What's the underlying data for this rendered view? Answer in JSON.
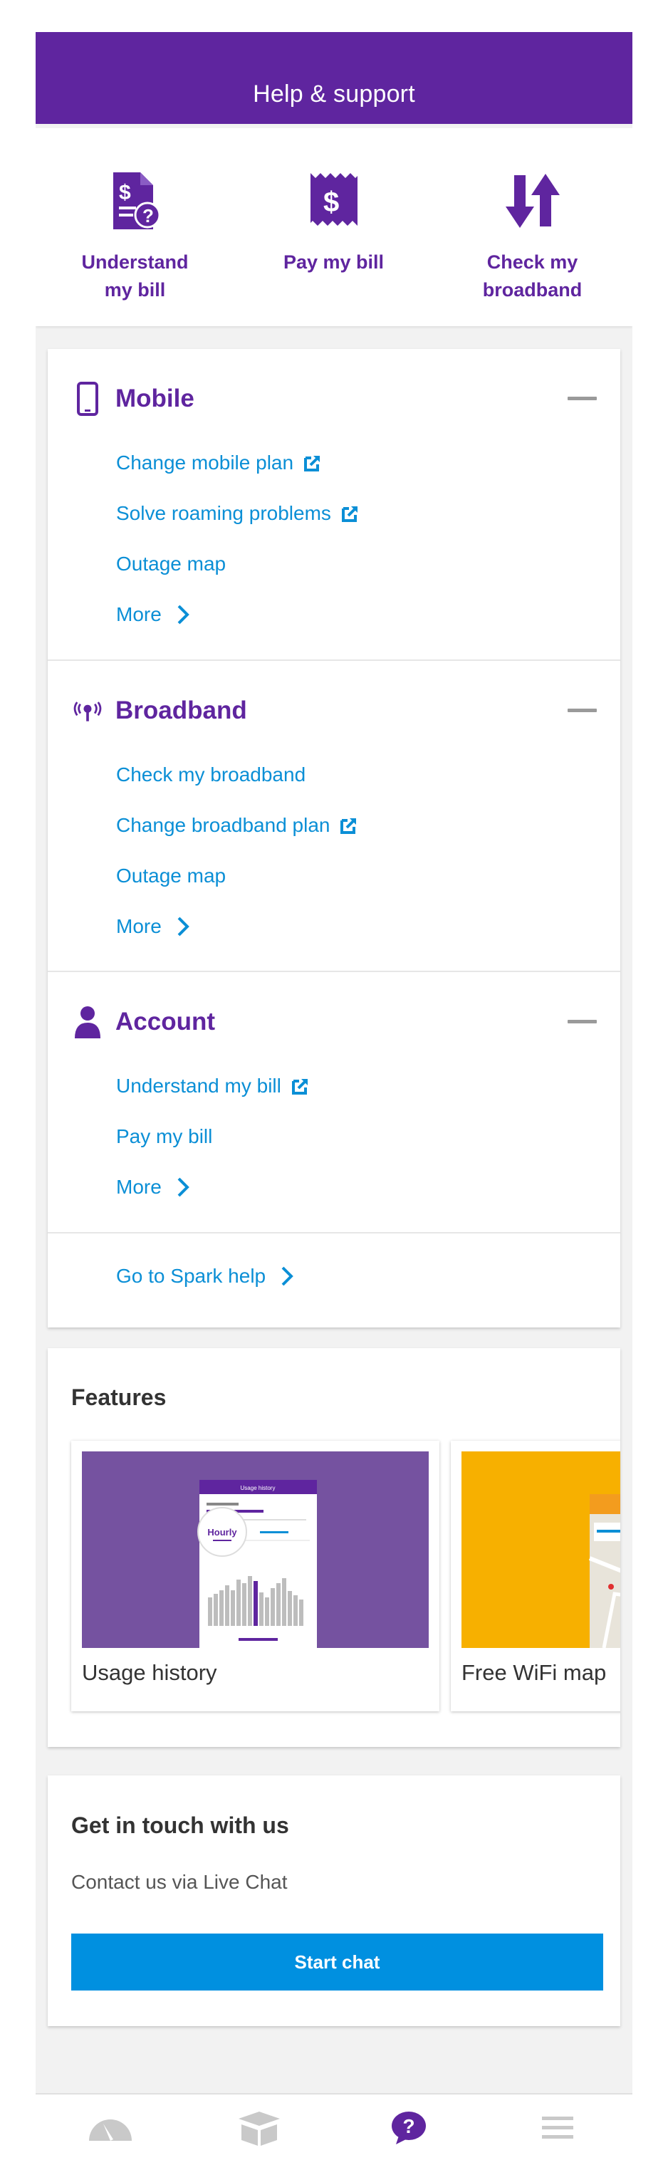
{
  "header": {
    "title": "Help & support"
  },
  "quick_actions": [
    {
      "label": "Understand\nmy bill",
      "icon": "bill-question-icon"
    },
    {
      "label": "Pay my bill",
      "icon": "dollar-receipt-icon"
    },
    {
      "label": "Check my\nbroadband",
      "icon": "up-down-arrows-icon"
    }
  ],
  "sections": {
    "mobile": {
      "title": "Mobile",
      "icon": "mobile-phone-icon",
      "links": [
        "Change mobile plan",
        "Solve roaming problems",
        "Outage map",
        "More"
      ]
    },
    "broadband": {
      "title": "Broadband",
      "icon": "broadband-signal-icon",
      "links": [
        "Check my broadband",
        "Change broadband plan",
        "Outage map",
        "More"
      ]
    },
    "account": {
      "title": "Account",
      "icon": "person-icon",
      "links": [
        "Understand my bill",
        "Pay my bill",
        "More"
      ]
    }
  },
  "spark_help": {
    "label": "Go to Spark help"
  },
  "features": {
    "title": "Features",
    "tiles": [
      {
        "label": "Usage history",
        "mock_title": "Usage history",
        "mock_badge": "Hourly"
      },
      {
        "label": "Free WiFi map"
      }
    ]
  },
  "contact": {
    "title": "Get in touch with us",
    "subtitle": "Contact us via Live Chat",
    "button": "Start chat"
  },
  "bottom_nav": [
    {
      "icon": "usage-gauge-icon",
      "active": false
    },
    {
      "icon": "box-icon",
      "active": false
    },
    {
      "icon": "help-chat-icon",
      "active": true
    },
    {
      "icon": "menu-icon",
      "active": false
    }
  ],
  "colors": {
    "brand_purple": "#5f259f",
    "link_blue": "#0b8fd6",
    "button_blue": "#0090e0",
    "feature_purple": "#7552a0",
    "feature_yellow": "#f7b000"
  }
}
